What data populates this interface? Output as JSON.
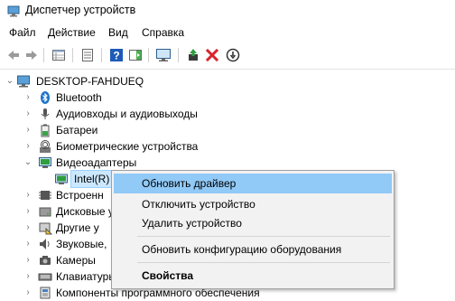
{
  "window": {
    "title": "Диспетчер устройств",
    "icon": "device-manager-icon"
  },
  "menu": [
    "Файл",
    "Действие",
    "Вид",
    "Справка"
  ],
  "toolbar_icons": [
    "back-arrow-icon",
    "forward-arrow-icon",
    "properties-grid-icon",
    "properties-page-icon",
    "help-icon",
    "action-pane-icon",
    "monitor-scan-icon",
    "add-driver-icon",
    "disable-device-icon",
    "uninstall-device-icon"
  ],
  "tree": {
    "root": "DESKTOP-FAHDUEQ",
    "items": [
      {
        "label": "Bluetooth",
        "icon": "bluetooth-icon"
      },
      {
        "label": "Аудиовходы и аудиовыходы",
        "icon": "audio-icon"
      },
      {
        "label": "Батареи",
        "icon": "battery-icon"
      },
      {
        "label": "Биометрические устройства",
        "icon": "biometric-icon"
      },
      {
        "label": "Видеоадаптеры",
        "icon": "display-adapter-icon",
        "expanded": true
      },
      {
        "label": "Intel(R)",
        "icon": "gpu-icon",
        "selected": true
      },
      {
        "label": "Встроенн",
        "icon": "firmware-icon"
      },
      {
        "label": "Дисковые у",
        "icon": "disk-icon"
      },
      {
        "label": "Другие у",
        "icon": "other-device-icon"
      },
      {
        "label": "Звуковые,",
        "icon": "sound-icon"
      },
      {
        "label": "Камеры",
        "icon": "camera-icon"
      },
      {
        "label": "Клавиатуры",
        "icon": "keyboard-icon"
      },
      {
        "label": "Компоненты программного обеспечения",
        "icon": "software-component-icon"
      }
    ]
  },
  "context_menu": {
    "items": [
      {
        "label": "Обновить драйвер",
        "highlighted": true
      },
      {
        "label": "Отключить устройство"
      },
      {
        "label": "Удалить устройство"
      },
      {
        "label": "Обновить конфигурацию оборудования"
      },
      {
        "label": "Свойства",
        "bold": true
      }
    ]
  },
  "colors": {
    "accent_green": "#2e9e3e",
    "delete_red": "#d9232d",
    "help_blue": "#1e5bb8",
    "highlight": "#91c9f7"
  }
}
